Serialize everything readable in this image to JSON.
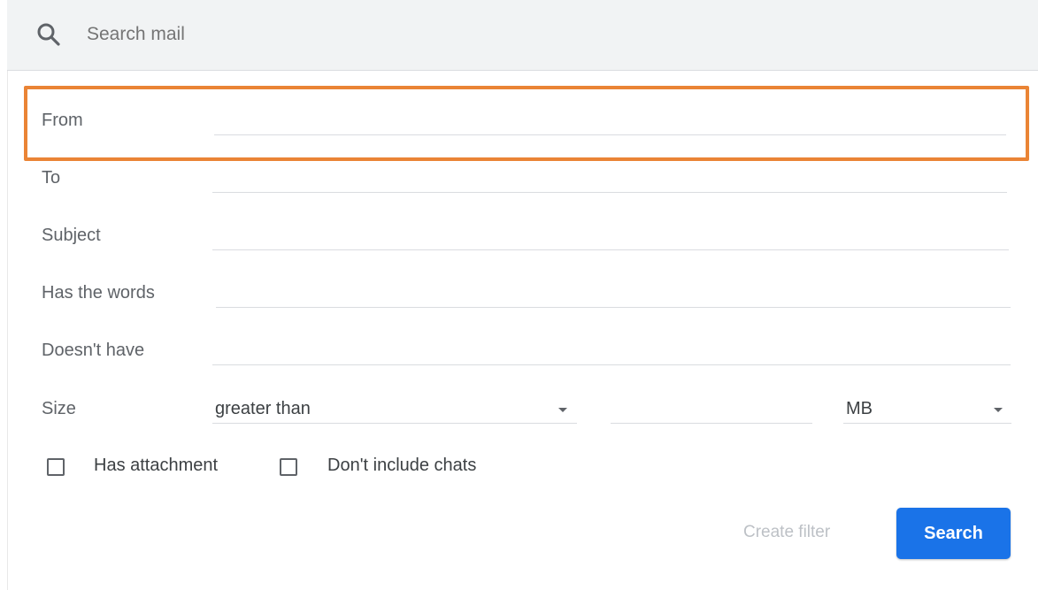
{
  "search": {
    "placeholder": "Search mail",
    "value": ""
  },
  "form": {
    "from_label": "From",
    "to_label": "To",
    "subject_label": "Subject",
    "has_words_label": "Has the words",
    "doesnt_have_label": "Doesn't have",
    "size_label": "Size",
    "size_operator": "greater than",
    "size_value": "",
    "size_unit": "MB",
    "has_attachment_label": "Has attachment",
    "has_attachment_checked": false,
    "no_chats_label": "Don't include chats",
    "no_chats_checked": false
  },
  "actions": {
    "create_filter_label": "Create filter",
    "search_label": "Search"
  },
  "colors": {
    "highlight": "#ea8435",
    "primary_button": "#1a73e8",
    "searchbar_bg": "#f1f3f4"
  }
}
